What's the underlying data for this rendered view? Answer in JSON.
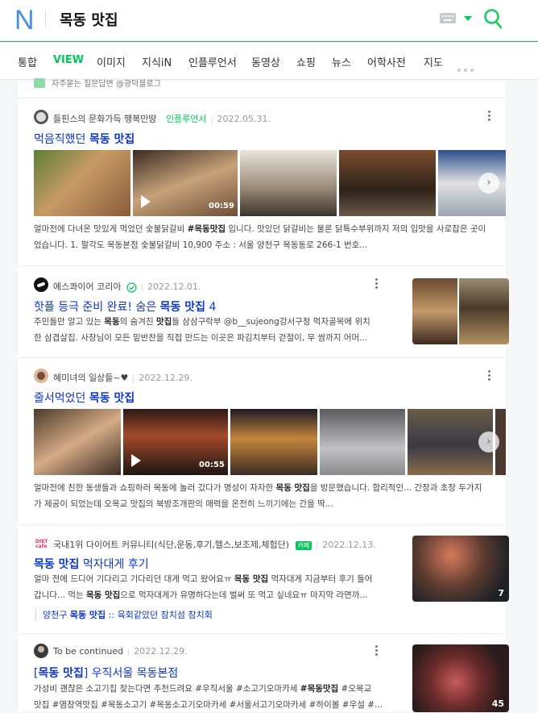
{
  "header": {
    "logo": "N",
    "query": "목동 맛집",
    "icons": [
      "keyboard-icon",
      "dropdown-caret-icon",
      "search-icon"
    ]
  },
  "tabs": [
    "통합",
    "VIEW",
    "이미지",
    "지식iN",
    "인플루언서",
    "동영상",
    "쇼핑",
    "뉴스",
    "어학사전",
    "지도"
  ],
  "active_tab": "VIEW",
  "partial_top": {
    "text": "자주묻는 질문답변 @광덕블로그"
  },
  "results": [
    {
      "author": "들핀스의 문화가득 행복만땅",
      "badge": "인플루언서",
      "date": "2022.05.31.",
      "title_pre": "먹음직했던 ",
      "title_hl": "목동 맛집",
      "title_post": "",
      "video_duration": "00:59",
      "desc_line1_pre": "얼마전에 다녀온 맛있게 먹었던 숯불닭갈비 ",
      "desc_line1_hl": "#목동맛집",
      "desc_line1_post": " 입니다. 맛있던 닭갈비는 물론 닭특수부위까지 저의 입맛을 사로잡은 곳이",
      "desc_line2": "었습니다. 1. 팔각도 목동본점 숯불닭갈비 10,900 주소 : 서울 양천구 목동동로 266-1 번호..."
    },
    {
      "author": "에스콰이어 코리아",
      "date": "2022.12.01.",
      "title_pre": "핫플 등극 준비 완료! 숨은 ",
      "title_hl": "목동 맛집",
      "title_post": " 4",
      "desc_line1_pre": "주민들만 알고 있는 ",
      "desc_line1_hl": "목동",
      "desc_line1_mid": "의 숨겨진 ",
      "desc_line1_hl2": "맛집",
      "desc_line1_post": "들 삼삼구락부 @b__sujeong강서구청 먹자골목에 위치",
      "desc_line2": "한 삼겹살집. 사장님이 모든 밑반찬을 직접 만드는 이곳은 파김치부터 걷절이, 무 쌈까지 어머..."
    },
    {
      "author": "혜미녀의 일상들~♥",
      "date": "2022.12.29.",
      "title_pre": "줄서먹었던 ",
      "title_hl": "목동 맛집",
      "title_post": "",
      "video_duration": "00:55",
      "desc_line1_pre": "얼마전에 친한 동생들과 쇼핑하러 목동에 놀러 갔다가 명성이 자자한 ",
      "desc_line1_hl": "목동 맛집",
      "desc_line1_post": "을 방문했습니다. 합리적인... 간장과 초장 두가지",
      "desc_line2": "가 제공이 되었는데 오목교 맛집의 북방조개판의 매력을 온전히 느끼기에는 간을 딱..."
    },
    {
      "author": "국내1위 다이어트 커뮤니티(식단,운동,후기,헬스,보조제,체험단)",
      "badge": "카페",
      "date": "2022.12.13.",
      "title_pre": "",
      "title_hl": "목동 맛집",
      "title_post": " 먹자대게 후기",
      "desc_line1_pre": "얼마 전에 드디어 기다리고 기다리던 대게 먹고 왔어요ㅠ ",
      "desc_line1_hl": "목동 맛집",
      "desc_line1_post": " 먹자대게 지금부터 후기 들어",
      "desc_line2_pre": "갑니다... 먹는 ",
      "desc_line2_hl": "목동 맛집",
      "desc_line2_post": "으로 먹자대게가 유명하다는데 벌써 또 먹고 싶네요ㅠ 마지막 라면까...",
      "sub_pre": "양천구 ",
      "sub_hl": "목동 맛집",
      "sub_post": " :: 육회같았던 참치섬 참치회",
      "thumb_count": "7"
    },
    {
      "author": "To be continued",
      "date": "2022.12.29.",
      "title_pre": "[",
      "title_hl": "목동 맛집",
      "title_post": "] 우직서울 목동본점",
      "desc_line1_pre": "가성비 괜찮은 소고기집 찾는다면 추천드려요 #우직서울 #소고기오마카세 ",
      "desc_line1_hl": "#목동맛집",
      "desc_line1_post": " #오목교",
      "desc_line2": "맛집 #염창역맛집 #목동소고기 #목동소고기오마카세 #서울서고기오마카세 #하이볼 #우설 #...",
      "thumb_count": "45"
    }
  ]
}
